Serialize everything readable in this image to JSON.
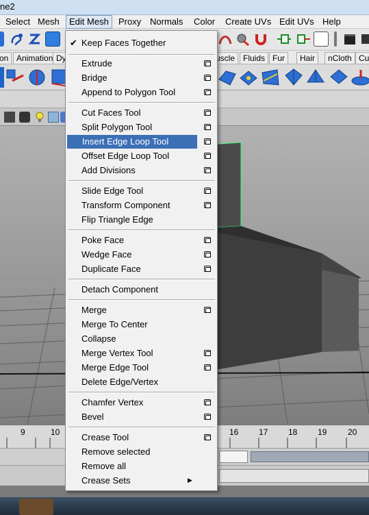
{
  "window": {
    "title_fragment": "ne2"
  },
  "menubar": {
    "items": [
      "Select",
      "Mesh",
      "Edit Mesh",
      "Proxy",
      "Normals",
      "Color",
      "Create UVs",
      "Edit UVs",
      "Help"
    ]
  },
  "shelf_tabs": {
    "left": [
      "on",
      "Animation",
      "Dy"
    ],
    "right": [
      "uscle",
      "Fluids",
      "Fur",
      "Hair",
      "nCloth",
      "Cus"
    ]
  },
  "edit_mesh_menu": {
    "keep_faces_together": "Keep Faces Together",
    "check_mark": "✔",
    "items": [
      "Extrude",
      "Bridge",
      "Append to Polygon Tool",
      "Cut Faces Tool",
      "Split Polygon Tool",
      "Insert Edge Loop Tool",
      "Offset Edge Loop Tool",
      "Add Divisions",
      "Slide Edge Tool",
      "Transform Component",
      "Flip Triangle Edge",
      "Poke Face",
      "Wedge Face",
      "Duplicate Face",
      "Detach Component",
      "Merge",
      "Merge To Center",
      "Collapse",
      "Merge Vertex Tool",
      "Merge Edge Tool",
      "Delete Edge/Vertex",
      "Chamfer Vertex",
      "Bevel",
      "Crease Tool",
      "Remove selected",
      "Remove all",
      "Crease Sets"
    ],
    "highlighted": "Insert Edge Loop Tool",
    "submenu_arrow": "▶"
  },
  "timeline": {
    "left_ticks": [
      "9",
      "10"
    ],
    "right_ticks": [
      "16",
      "17",
      "18",
      "19",
      "20"
    ]
  },
  "colors": {
    "highlight": "#3b6fb6",
    "menu_bg": "#f1f1f1",
    "selection_wire": "#3fff7a"
  }
}
